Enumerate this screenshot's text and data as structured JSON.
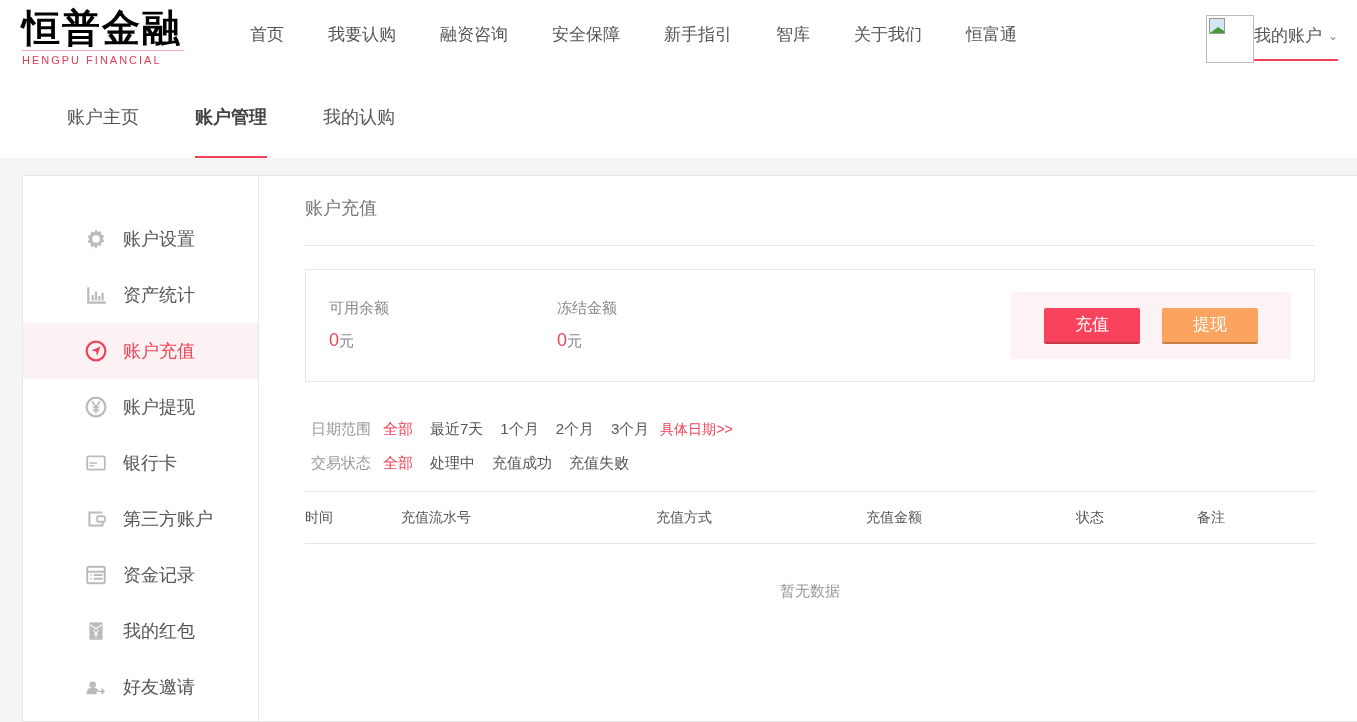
{
  "logo": {
    "title": "恒普金融",
    "subtitle": "HENGPU FINANCIAL"
  },
  "nav": [
    "首页",
    "我要认购",
    "融资咨询",
    "安全保障",
    "新手指引",
    "智库",
    "关于我们",
    "恒富通"
  ],
  "account_menu": {
    "label": "我的账户",
    "caret": "⌄"
  },
  "subtabs": [
    {
      "label": "账户主页",
      "selected": false
    },
    {
      "label": "账户管理",
      "selected": true
    },
    {
      "label": "我的认购",
      "selected": false
    }
  ],
  "sidebar": {
    "items": [
      {
        "label": "账户设置",
        "selected": false
      },
      {
        "label": "资产统计",
        "selected": false
      },
      {
        "label": "账户充值",
        "selected": true
      },
      {
        "label": "账户提现",
        "selected": false
      },
      {
        "label": "银行卡",
        "selected": false
      },
      {
        "label": "第三方账户",
        "selected": false
      },
      {
        "label": "资金记录",
        "selected": false
      },
      {
        "label": "我的红包",
        "selected": false
      },
      {
        "label": "好友邀请",
        "selected": false
      }
    ]
  },
  "page_title": "账户充值",
  "balances": [
    {
      "label": "可用余额",
      "amount": "0",
      "unit": "元"
    },
    {
      "label": "冻结金额",
      "amount": "0",
      "unit": "元"
    }
  ],
  "buttons": [
    {
      "label": "充值",
      "kind": "primary"
    },
    {
      "label": "提现",
      "kind": "secondary"
    }
  ],
  "filters": [
    {
      "label": "日期范围",
      "options": [
        {
          "text": "全部",
          "kind": "option",
          "selected": true
        },
        {
          "text": "最近7天",
          "kind": "option",
          "selected": false
        },
        {
          "text": "1个月",
          "kind": "option",
          "selected": false
        },
        {
          "text": "2个月",
          "kind": "option",
          "selected": false
        },
        {
          "text": "3个月",
          "kind": "option",
          "selected": false
        },
        {
          "text": "具体日期>>",
          "kind": "link",
          "selected": false
        }
      ]
    },
    {
      "label": "交易状态",
      "options": [
        {
          "text": "全部",
          "kind": "option",
          "selected": true
        },
        {
          "text": "处理中",
          "kind": "option",
          "selected": false
        },
        {
          "text": "充值成功",
          "kind": "option",
          "selected": false
        },
        {
          "text": "充值失败",
          "kind": "option",
          "selected": false
        }
      ]
    }
  ],
  "table": {
    "columns": [
      "时间",
      "充值流水号",
      "充值方式",
      "充值金额",
      "状态",
      "备注"
    ],
    "empty_text": "暂无数据"
  }
}
